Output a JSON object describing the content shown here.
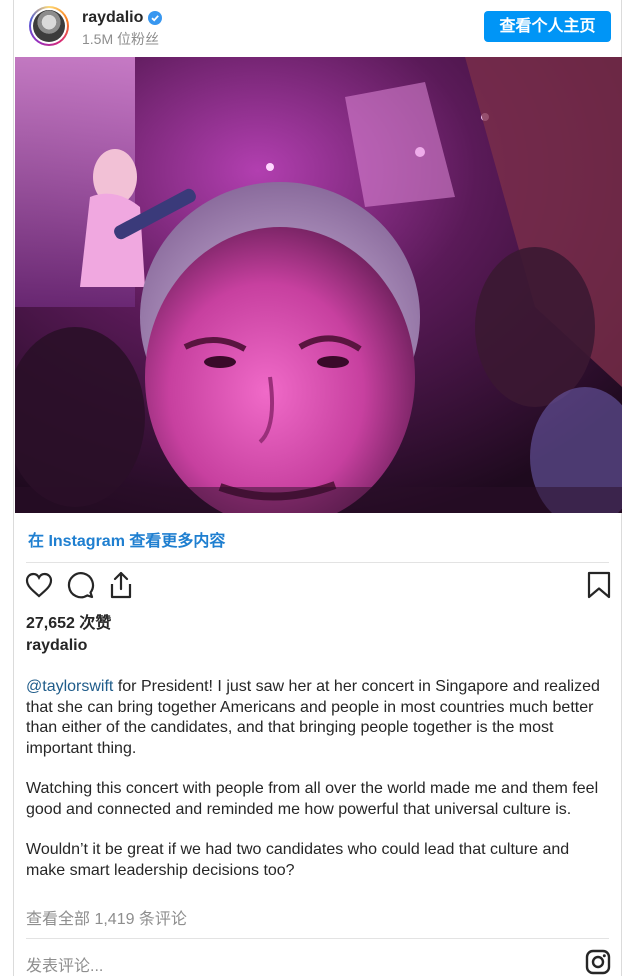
{
  "header": {
    "username": "raydalio",
    "followers": "1.5M 位粉丝",
    "view_profile": "查看个人主页"
  },
  "more_link": "在 Instagram 查看更多内容",
  "likes": "27,652 次赞",
  "author": "raydalio",
  "caption": {
    "mention": "@taylorswift",
    "p1_rest": " for President! I just saw her at her concert in Singapore and realized that she can bring together Americans and people in most countries much better than either of the candidates, and that bringing people together is the most important thing.",
    "p2": "Watching this concert with people from all over the world made me and them feel good and connected and reminded me how powerful that universal culture is.",
    "p3": "Wouldn’t it be great if we had two candidates who could lead that culture and make smart leadership decisions too?"
  },
  "comments_link": "查看全部 1,419 条评论",
  "comment_placeholder": "发表评论...",
  "colors": {
    "accent": "#0095f6",
    "link": "#1f7fd0",
    "muted": "#8e8e8e"
  },
  "icons": [
    "verified-badge-icon",
    "heart-icon",
    "comment-icon",
    "share-icon",
    "bookmark-icon",
    "instagram-icon"
  ]
}
